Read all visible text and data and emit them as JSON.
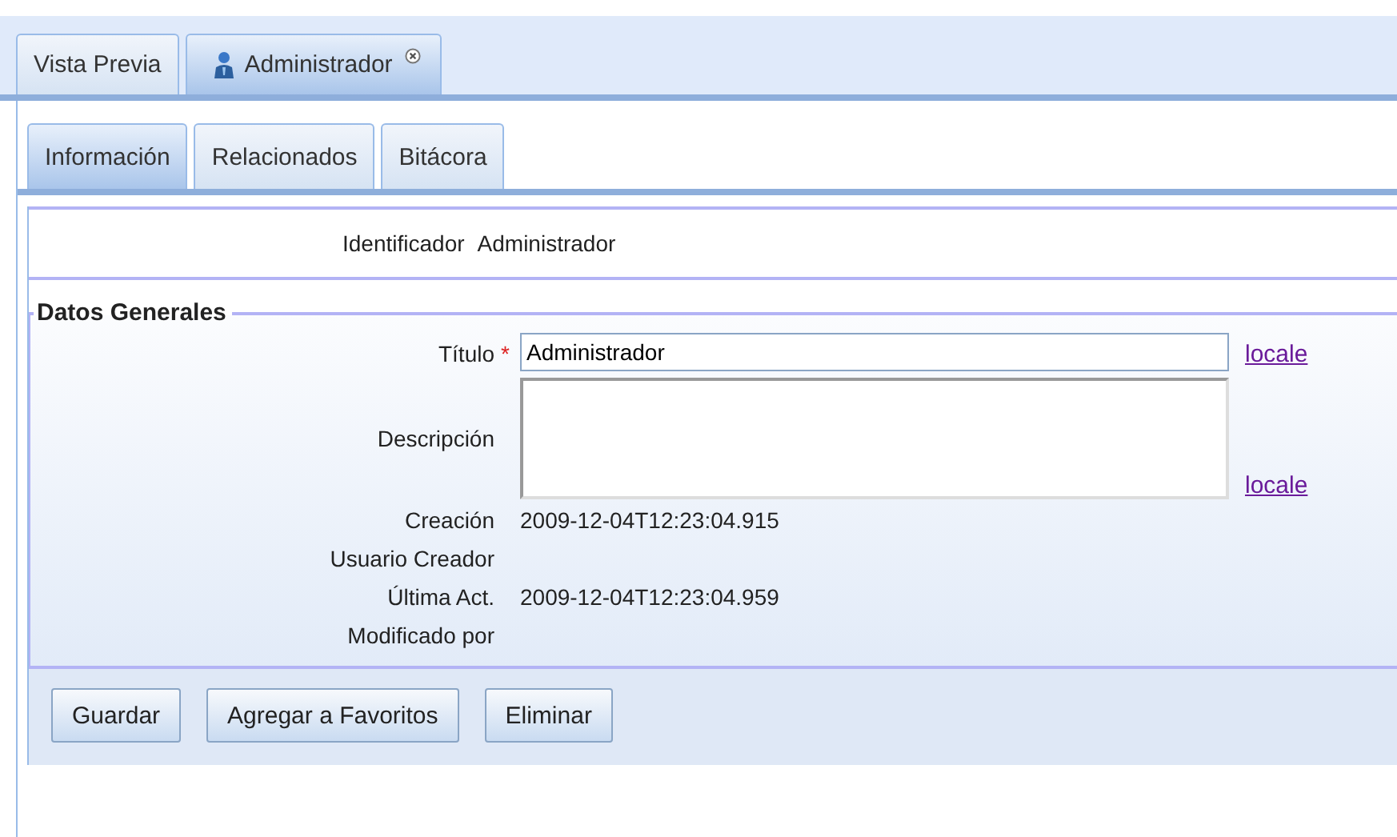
{
  "outer_tabs": [
    {
      "label": "Vista Previa",
      "selected": false,
      "kind": "plain",
      "closable": false
    },
    {
      "label": "Administrador",
      "selected": true,
      "kind": "user",
      "closable": true
    }
  ],
  "inner_tabs": [
    {
      "label": "Información",
      "selected": true
    },
    {
      "label": "Relacionados",
      "selected": false
    },
    {
      "label": "Bitácora",
      "selected": false
    }
  ],
  "identifier": {
    "label": "Identificador",
    "value": "Administrador"
  },
  "section": {
    "title": "Datos Generales",
    "fields": [
      {
        "kind": "text",
        "label": "Título",
        "required_mark": "*",
        "value": "Administrador",
        "link": "locale"
      },
      {
        "kind": "textarea",
        "label": "Descripción",
        "link": "locale"
      },
      {
        "kind": "info",
        "label": "Creación",
        "value": "2009-12-04T12:23:04.915"
      },
      {
        "kind": "info",
        "label": "Usuario Creador"
      },
      {
        "kind": "info",
        "label": "Última Act.",
        "value": "2009-12-04T12:23:04.959"
      },
      {
        "kind": "info",
        "label": "Modificado por"
      }
    ]
  },
  "buttons": [
    "Guardar",
    "Agregar a Favoritos",
    "Eliminar"
  ]
}
